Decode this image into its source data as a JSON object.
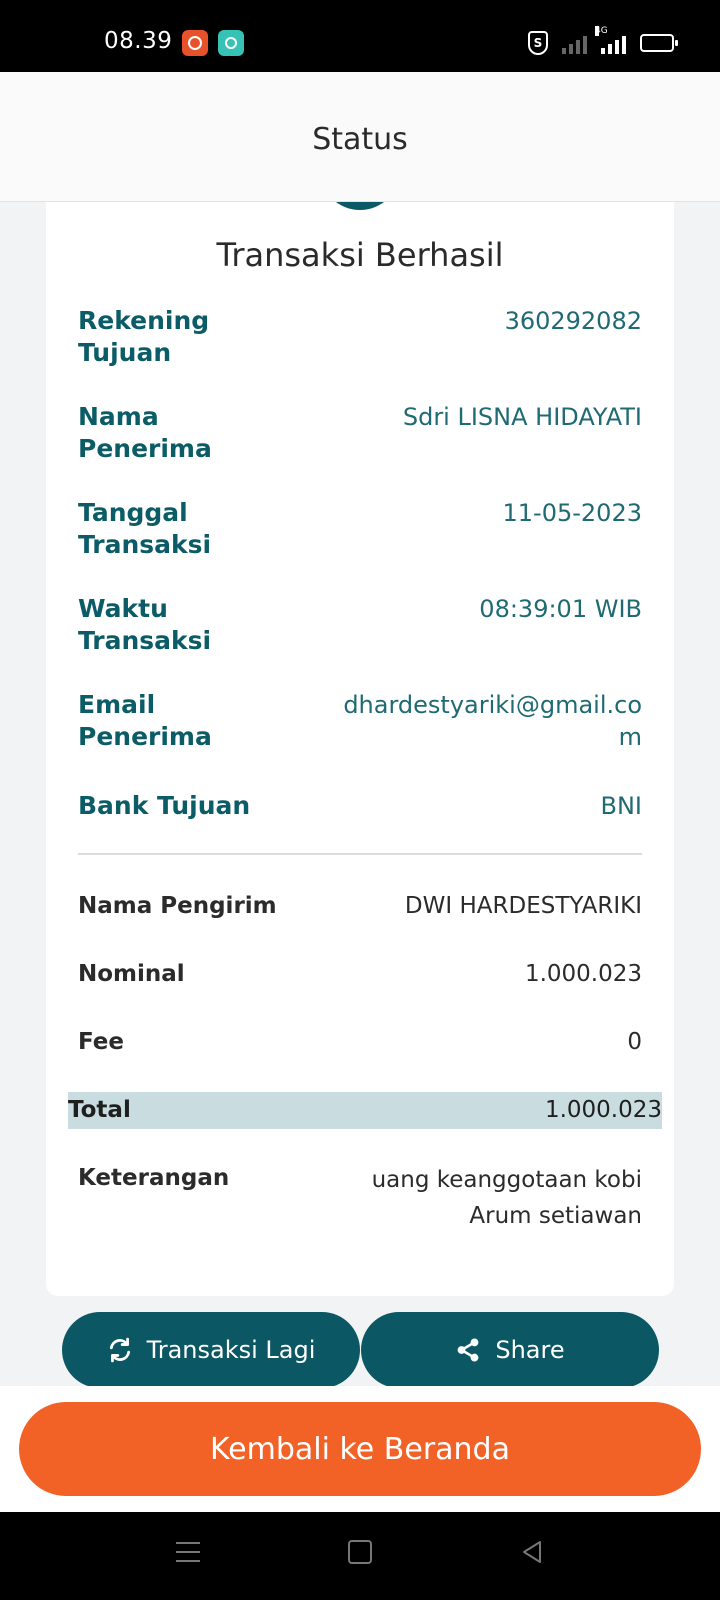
{
  "status_bar": {
    "time": "08.39",
    "network_label": "4G",
    "icons": [
      "app-notification-icon",
      "message-notification-icon",
      "shield-icon",
      "signal-icon",
      "battery-icon"
    ]
  },
  "header": {
    "title": "Status"
  },
  "card": {
    "title": "Transaksi Berhasil",
    "rows": [
      {
        "label": "Rekening Tujuan",
        "value": "360292082"
      },
      {
        "label": "Nama Penerima",
        "value": "Sdri LISNA HIDAYATI"
      },
      {
        "label": "Tanggal Transaksi",
        "value": "11-05-2023"
      },
      {
        "label": "Waktu Transaksi",
        "value": "08:39:01 WIB"
      },
      {
        "label": "Email Penerima",
        "value": "dhardestyariki@gmail.com"
      },
      {
        "label": "Bank Tujuan",
        "value": "BNI"
      }
    ],
    "summary": [
      {
        "label": "Nama Pengirim",
        "value": "DWI HARDESTYARIKI"
      },
      {
        "label": "Nominal",
        "value": "1.000.023"
      },
      {
        "label": "Fee",
        "value": "0"
      }
    ],
    "total": {
      "label": "Total",
      "value": "1.000.023"
    },
    "note": {
      "label": "Keterangan",
      "value": "uang keanggotaan kobi Arum setiawan"
    }
  },
  "actions": {
    "again_label": "Transaksi Lagi",
    "share_label": "Share",
    "home_label": "Kembali ke Beranda"
  },
  "colors": {
    "primary": "#0b5864",
    "accent": "#f26226",
    "total_band": "#c9dde0"
  }
}
